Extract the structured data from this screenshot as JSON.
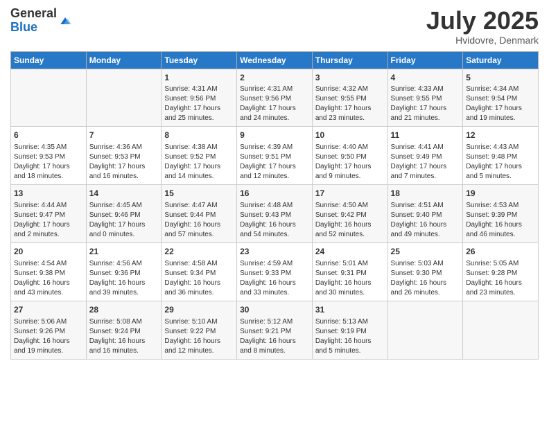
{
  "logo": {
    "general": "General",
    "blue": "Blue"
  },
  "header": {
    "month": "July 2025",
    "location": "Hvidovre, Denmark"
  },
  "days_of_week": [
    "Sunday",
    "Monday",
    "Tuesday",
    "Wednesday",
    "Thursday",
    "Friday",
    "Saturday"
  ],
  "weeks": [
    [
      {
        "day": "",
        "info": ""
      },
      {
        "day": "",
        "info": ""
      },
      {
        "day": "1",
        "info": "Sunrise: 4:31 AM\nSunset: 9:56 PM\nDaylight: 17 hours and 25 minutes."
      },
      {
        "day": "2",
        "info": "Sunrise: 4:31 AM\nSunset: 9:56 PM\nDaylight: 17 hours and 24 minutes."
      },
      {
        "day": "3",
        "info": "Sunrise: 4:32 AM\nSunset: 9:55 PM\nDaylight: 17 hours and 23 minutes."
      },
      {
        "day": "4",
        "info": "Sunrise: 4:33 AM\nSunset: 9:55 PM\nDaylight: 17 hours and 21 minutes."
      },
      {
        "day": "5",
        "info": "Sunrise: 4:34 AM\nSunset: 9:54 PM\nDaylight: 17 hours and 19 minutes."
      }
    ],
    [
      {
        "day": "6",
        "info": "Sunrise: 4:35 AM\nSunset: 9:53 PM\nDaylight: 17 hours and 18 minutes."
      },
      {
        "day": "7",
        "info": "Sunrise: 4:36 AM\nSunset: 9:53 PM\nDaylight: 17 hours and 16 minutes."
      },
      {
        "day": "8",
        "info": "Sunrise: 4:38 AM\nSunset: 9:52 PM\nDaylight: 17 hours and 14 minutes."
      },
      {
        "day": "9",
        "info": "Sunrise: 4:39 AM\nSunset: 9:51 PM\nDaylight: 17 hours and 12 minutes."
      },
      {
        "day": "10",
        "info": "Sunrise: 4:40 AM\nSunset: 9:50 PM\nDaylight: 17 hours and 9 minutes."
      },
      {
        "day": "11",
        "info": "Sunrise: 4:41 AM\nSunset: 9:49 PM\nDaylight: 17 hours and 7 minutes."
      },
      {
        "day": "12",
        "info": "Sunrise: 4:43 AM\nSunset: 9:48 PM\nDaylight: 17 hours and 5 minutes."
      }
    ],
    [
      {
        "day": "13",
        "info": "Sunrise: 4:44 AM\nSunset: 9:47 PM\nDaylight: 17 hours and 2 minutes."
      },
      {
        "day": "14",
        "info": "Sunrise: 4:45 AM\nSunset: 9:46 PM\nDaylight: 17 hours and 0 minutes."
      },
      {
        "day": "15",
        "info": "Sunrise: 4:47 AM\nSunset: 9:44 PM\nDaylight: 16 hours and 57 minutes."
      },
      {
        "day": "16",
        "info": "Sunrise: 4:48 AM\nSunset: 9:43 PM\nDaylight: 16 hours and 54 minutes."
      },
      {
        "day": "17",
        "info": "Sunrise: 4:50 AM\nSunset: 9:42 PM\nDaylight: 16 hours and 52 minutes."
      },
      {
        "day": "18",
        "info": "Sunrise: 4:51 AM\nSunset: 9:40 PM\nDaylight: 16 hours and 49 minutes."
      },
      {
        "day": "19",
        "info": "Sunrise: 4:53 AM\nSunset: 9:39 PM\nDaylight: 16 hours and 46 minutes."
      }
    ],
    [
      {
        "day": "20",
        "info": "Sunrise: 4:54 AM\nSunset: 9:38 PM\nDaylight: 16 hours and 43 minutes."
      },
      {
        "day": "21",
        "info": "Sunrise: 4:56 AM\nSunset: 9:36 PM\nDaylight: 16 hours and 39 minutes."
      },
      {
        "day": "22",
        "info": "Sunrise: 4:58 AM\nSunset: 9:34 PM\nDaylight: 16 hours and 36 minutes."
      },
      {
        "day": "23",
        "info": "Sunrise: 4:59 AM\nSunset: 9:33 PM\nDaylight: 16 hours and 33 minutes."
      },
      {
        "day": "24",
        "info": "Sunrise: 5:01 AM\nSunset: 9:31 PM\nDaylight: 16 hours and 30 minutes."
      },
      {
        "day": "25",
        "info": "Sunrise: 5:03 AM\nSunset: 9:30 PM\nDaylight: 16 hours and 26 minutes."
      },
      {
        "day": "26",
        "info": "Sunrise: 5:05 AM\nSunset: 9:28 PM\nDaylight: 16 hours and 23 minutes."
      }
    ],
    [
      {
        "day": "27",
        "info": "Sunrise: 5:06 AM\nSunset: 9:26 PM\nDaylight: 16 hours and 19 minutes."
      },
      {
        "day": "28",
        "info": "Sunrise: 5:08 AM\nSunset: 9:24 PM\nDaylight: 16 hours and 16 minutes."
      },
      {
        "day": "29",
        "info": "Sunrise: 5:10 AM\nSunset: 9:22 PM\nDaylight: 16 hours and 12 minutes."
      },
      {
        "day": "30",
        "info": "Sunrise: 5:12 AM\nSunset: 9:21 PM\nDaylight: 16 hours and 8 minutes."
      },
      {
        "day": "31",
        "info": "Sunrise: 5:13 AM\nSunset: 9:19 PM\nDaylight: 16 hours and 5 minutes."
      },
      {
        "day": "",
        "info": ""
      },
      {
        "day": "",
        "info": ""
      }
    ]
  ]
}
